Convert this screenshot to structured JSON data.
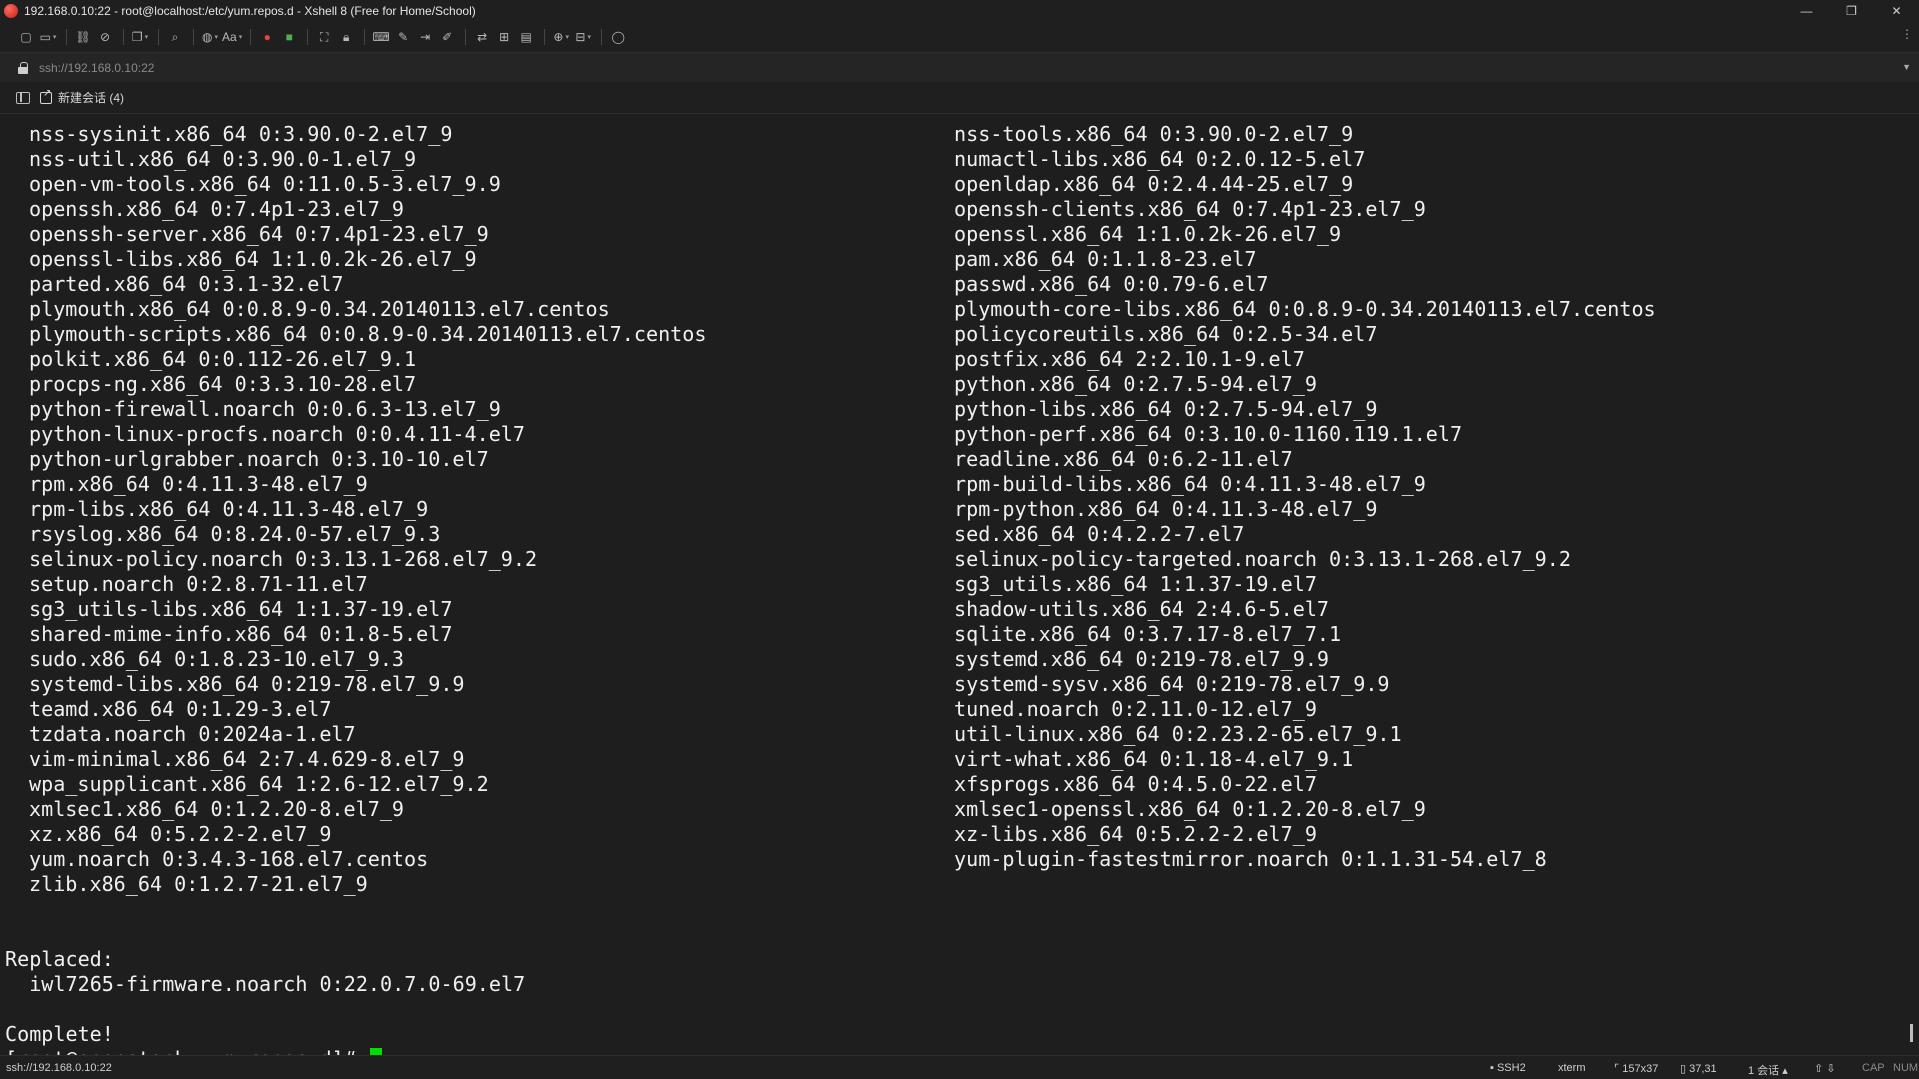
{
  "window": {
    "title": "192.168.0.10:22 - root@localhost:/etc/yum.repos.d - Xshell 8 (Free for Home/School)",
    "controls": [
      "—",
      "❐",
      "✕"
    ]
  },
  "address": {
    "text": "ssh://192.168.0.10:22"
  },
  "tabs": {
    "new_session_label": "新建会话 (4)"
  },
  "terminal": {
    "left_column": [
      "nss-sysinit.x86_64 0:3.90.0-2.el7_9",
      "nss-util.x86_64 0:3.90.0-1.el7_9",
      "open-vm-tools.x86_64 0:11.0.5-3.el7_9.9",
      "openssh.x86_64 0:7.4p1-23.el7_9",
      "openssh-server.x86_64 0:7.4p1-23.el7_9",
      "openssl-libs.x86_64 1:1.0.2k-26.el7_9",
      "parted.x86_64 0:3.1-32.el7",
      "plymouth.x86_64 0:0.8.9-0.34.20140113.el7.centos",
      "plymouth-scripts.x86_64 0:0.8.9-0.34.20140113.el7.centos",
      "polkit.x86_64 0:0.112-26.el7_9.1",
      "procps-ng.x86_64 0:3.3.10-28.el7",
      "python-firewall.noarch 0:0.6.3-13.el7_9",
      "python-linux-procfs.noarch 0:0.4.11-4.el7",
      "python-urlgrabber.noarch 0:3.10-10.el7",
      "rpm.x86_64 0:4.11.3-48.el7_9",
      "rpm-libs.x86_64 0:4.11.3-48.el7_9",
      "rsyslog.x86_64 0:8.24.0-57.el7_9.3",
      "selinux-policy.noarch 0:3.13.1-268.el7_9.2",
      "setup.noarch 0:2.8.71-11.el7",
      "sg3_utils-libs.x86_64 1:1.37-19.el7",
      "shared-mime-info.x86_64 0:1.8-5.el7",
      "sudo.x86_64 0:1.8.23-10.el7_9.3",
      "systemd-libs.x86_64 0:219-78.el7_9.9",
      "teamd.x86_64 0:1.29-3.el7",
      "tzdata.noarch 0:2024a-1.el7",
      "vim-minimal.x86_64 2:7.4.629-8.el7_9",
      "wpa_supplicant.x86_64 1:2.6-12.el7_9.2",
      "xmlsec1.x86_64 0:1.2.20-8.el7_9",
      "xz.x86_64 0:5.2.2-2.el7_9",
      "yum.noarch 0:3.4.3-168.el7.centos",
      "zlib.x86_64 0:1.2.7-21.el7_9"
    ],
    "right_column": [
      "nss-tools.x86_64 0:3.90.0-2.el7_9",
      "numactl-libs.x86_64 0:2.0.12-5.el7",
      "openldap.x86_64 0:2.4.44-25.el7_9",
      "openssh-clients.x86_64 0:7.4p1-23.el7_9",
      "openssl.x86_64 1:1.0.2k-26.el7_9",
      "pam.x86_64 0:1.1.8-23.el7",
      "passwd.x86_64 0:0.79-6.el7",
      "plymouth-core-libs.x86_64 0:0.8.9-0.34.20140113.el7.centos",
      "policycoreutils.x86_64 0:2.5-34.el7",
      "postfix.x86_64 2:2.10.1-9.el7",
      "python.x86_64 0:2.7.5-94.el7_9",
      "python-libs.x86_64 0:2.7.5-94.el7_9",
      "python-perf.x86_64 0:3.10.0-1160.119.1.el7",
      "readline.x86_64 0:6.2-11.el7",
      "rpm-build-libs.x86_64 0:4.11.3-48.el7_9",
      "rpm-python.x86_64 0:4.11.3-48.el7_9",
      "sed.x86_64 0:4.2.2-7.el7",
      "selinux-policy-targeted.noarch 0:3.13.1-268.el7_9.2",
      "sg3_utils.x86_64 1:1.37-19.el7",
      "shadow-utils.x86_64 2:4.6-5.el7",
      "sqlite.x86_64 0:3.7.17-8.el7_7.1",
      "systemd.x86_64 0:219-78.el7_9.9",
      "systemd-sysv.x86_64 0:219-78.el7_9.9",
      "tuned.noarch 0:2.11.0-12.el7_9",
      "util-linux.x86_64 0:2.23.2-65.el7_9.1",
      "virt-what.x86_64 0:1.18-4.el7_9.1",
      "xfsprogs.x86_64 0:4.5.0-22.el7",
      "xmlsec1-openssl.x86_64 0:1.2.20-8.el7_9",
      "xz-libs.x86_64 0:5.2.2-2.el7_9",
      "yum-plugin-fastestmirror.noarch 0:1.1.31-54.el7_8"
    ],
    "replaced_label": "Replaced:",
    "replaced_item": "iwl7265-firmware.noarch 0:22.0.7.0-69.el7",
    "complete_text": "Complete!",
    "prompt": "[root@openstack yum.repos.d]# "
  },
  "statusbar": {
    "connection": "ssh://192.168.0.10:22",
    "protocol": "SSH2",
    "terminal_type": "xterm",
    "size": "157x37",
    "cursor_pos": "37,31",
    "sessions": "1 会话",
    "caps": "CAP",
    "num": "NUM"
  },
  "colors": {
    "background": "#1e1e1e",
    "text": "#f0f0f0",
    "cursor": "#00e000"
  }
}
